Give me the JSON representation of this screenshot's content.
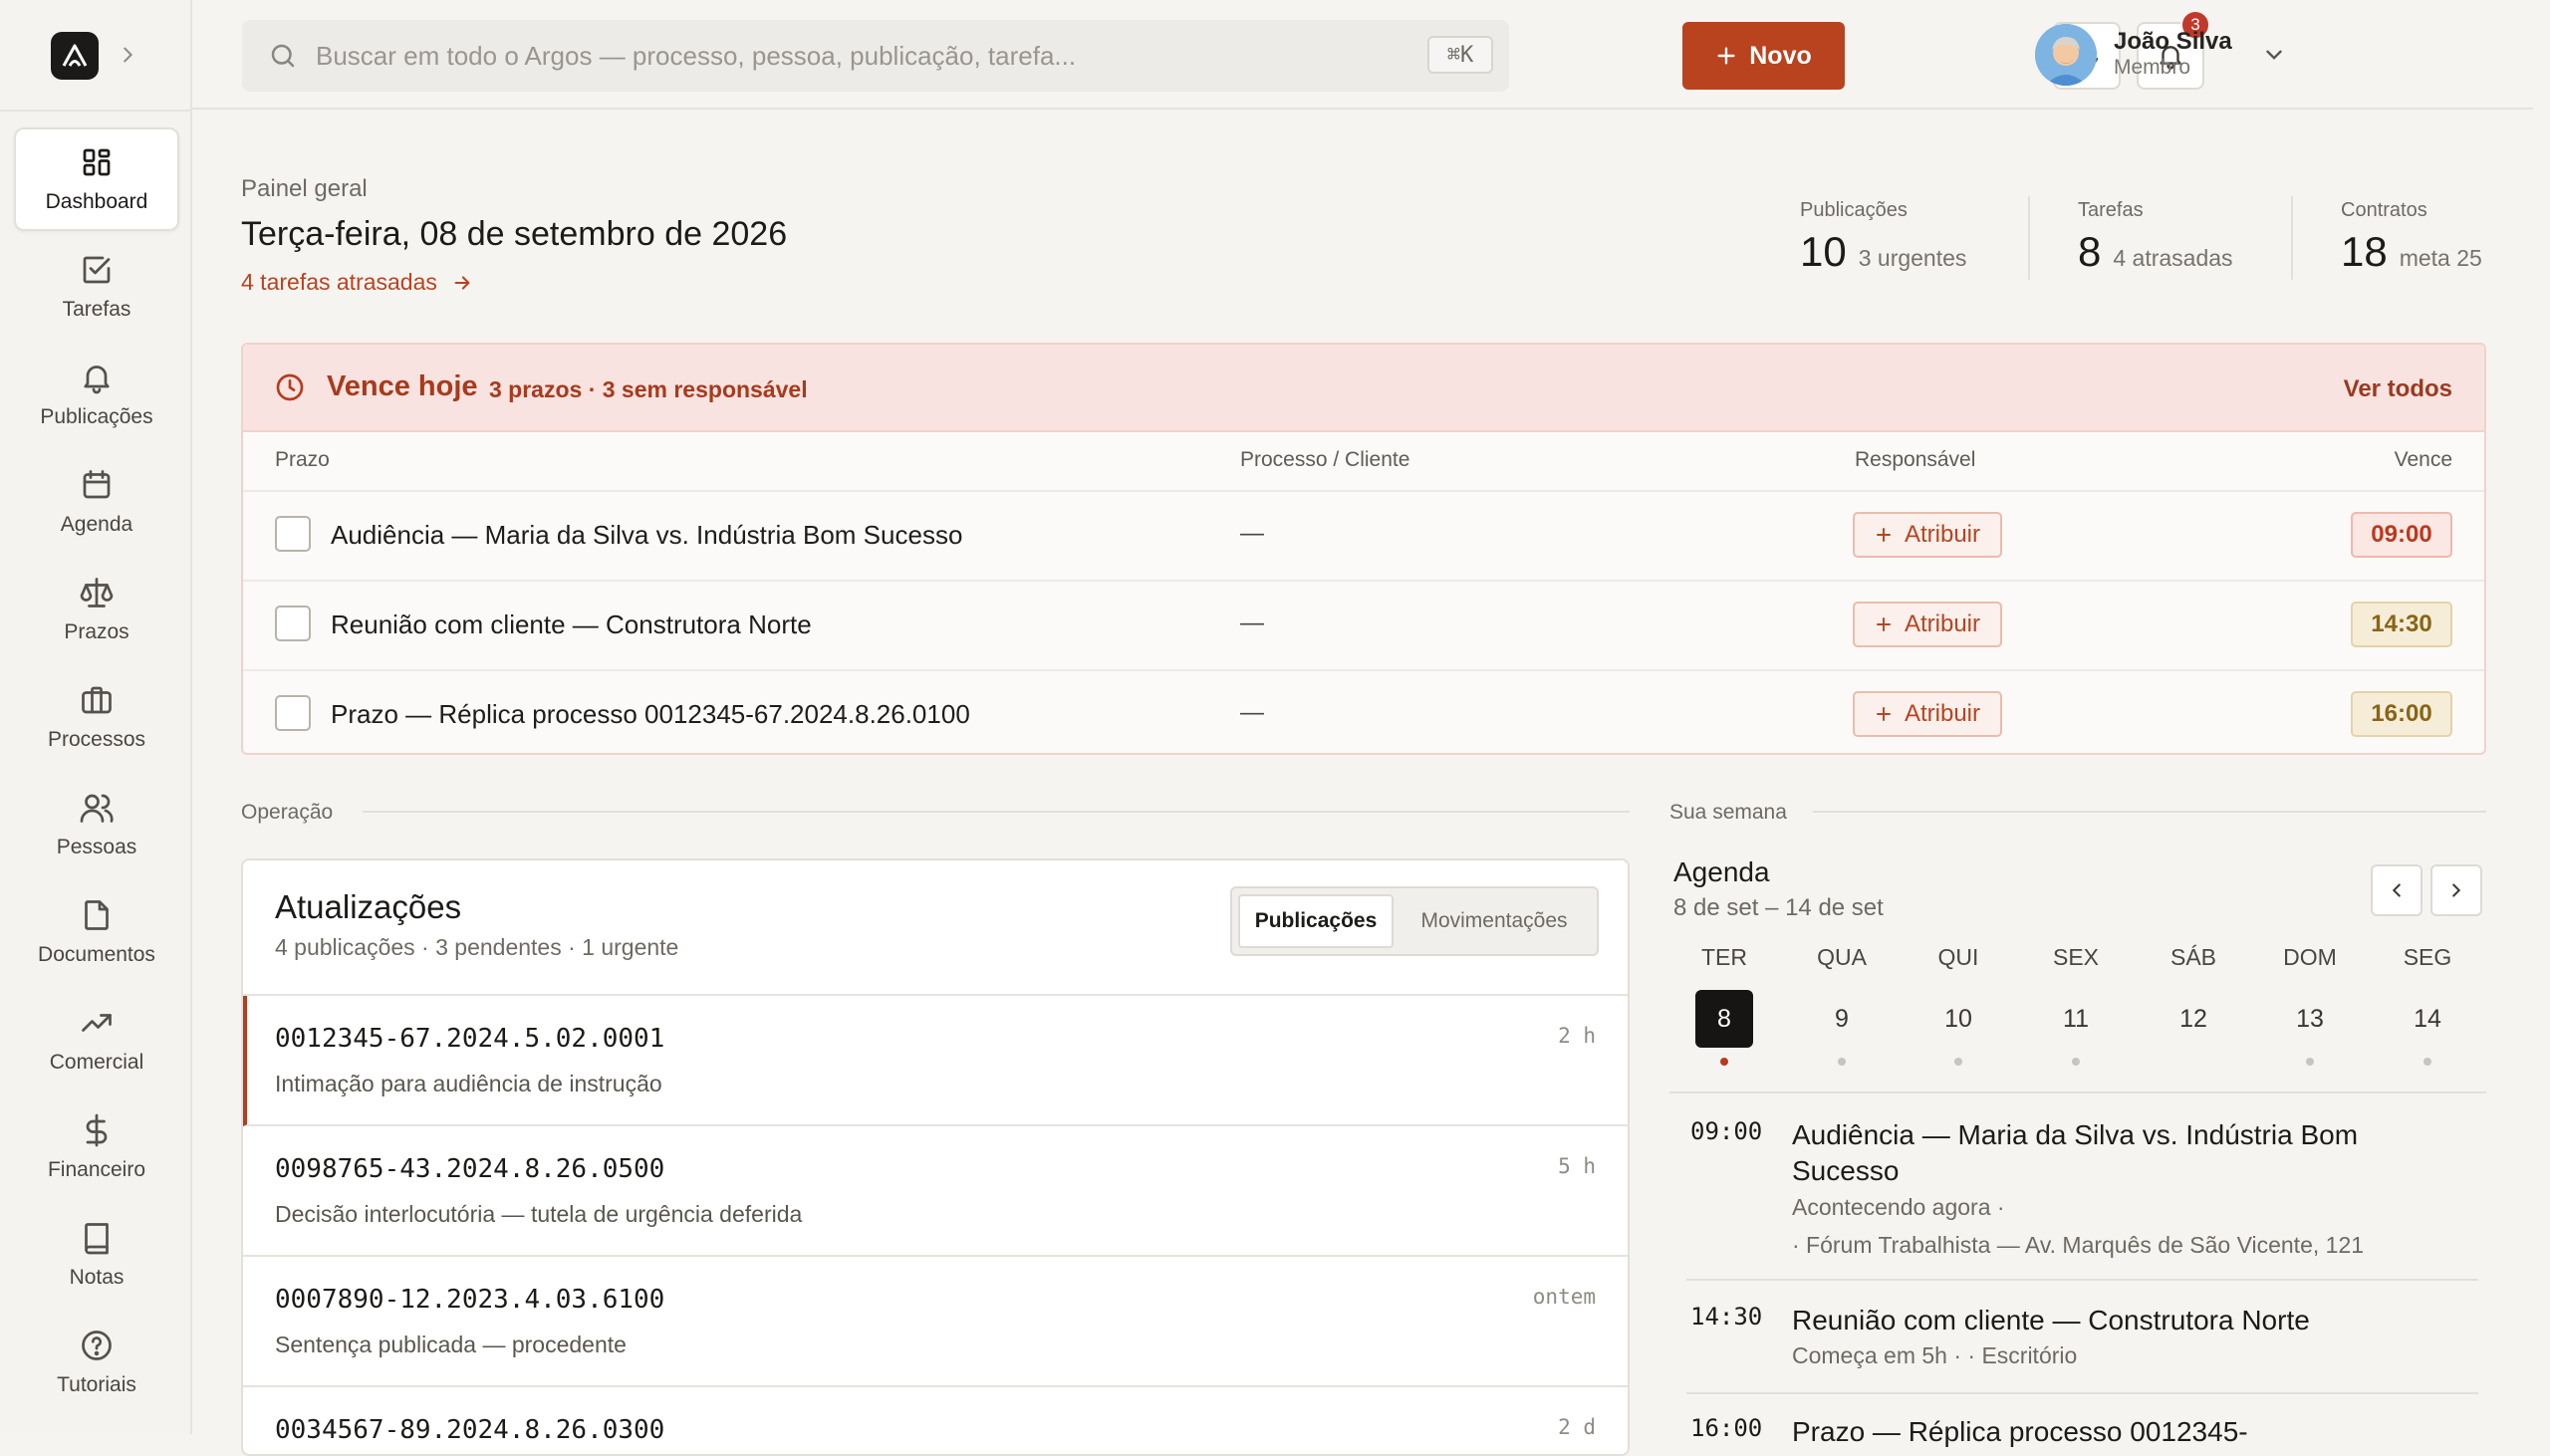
{
  "search": {
    "placeholder": "Buscar em todo o Argos — processo, pessoa, publicação, tarefa...",
    "shortcut": "⌘K"
  },
  "header": {
    "new_label": "Novo",
    "notifications_count": "3",
    "user": {
      "name": "João Silva",
      "role": "Membro"
    }
  },
  "sidebar": {
    "items": [
      {
        "label": "Dashboard",
        "icon": "grid-icon",
        "active": true
      },
      {
        "label": "Tarefas",
        "icon": "checkbox-icon"
      },
      {
        "label": "Publicações",
        "icon": "bell-icon"
      },
      {
        "label": "Agenda",
        "icon": "calendar-icon"
      },
      {
        "label": "Prazos",
        "icon": "scale-icon"
      },
      {
        "label": "Processos",
        "icon": "briefcase-icon"
      },
      {
        "label": "Pessoas",
        "icon": "users-icon"
      },
      {
        "label": "Documentos",
        "icon": "file-icon"
      },
      {
        "label": "Comercial",
        "icon": "trending-up-icon"
      },
      {
        "label": "Financeiro",
        "icon": "dollar-icon"
      },
      {
        "label": "Notas",
        "icon": "book-icon"
      },
      {
        "label": "Tutoriais",
        "icon": "help-circle-icon"
      }
    ]
  },
  "page": {
    "kicker": "Painel geral",
    "title": "Terça-feira, 08 de setembro de 2026",
    "overdue_link": "4 tarefas atrasadas"
  },
  "stats": [
    {
      "label": "Publicações",
      "value": "10",
      "sub": "3 urgentes"
    },
    {
      "label": "Tarefas",
      "value": "8",
      "sub": "4 atrasadas"
    },
    {
      "label": "Contratos",
      "value": "18",
      "sub": "meta 25"
    }
  ],
  "due_today": {
    "title": "Vence hoje",
    "subtitle": "3 prazos · 3 sem responsável",
    "see_all": "Ver todos",
    "columns": {
      "prazo": "Prazo",
      "processo": "Processo / Cliente",
      "responsavel": "Responsável",
      "vence": "Vence"
    },
    "assign_label": "Atribuir",
    "rows": [
      {
        "title": "Audiência — Maria da Silva vs. Indústria Bom Sucesso",
        "process": "—",
        "time": "09:00",
        "tone": "red"
      },
      {
        "title": "Reunião com cliente — Construtora Norte",
        "process": "—",
        "time": "14:30",
        "tone": "amber"
      },
      {
        "title": "Prazo — Réplica processo 0012345-67.2024.8.26.0100",
        "process": "—",
        "time": "16:00",
        "tone": "amber"
      }
    ]
  },
  "sections": {
    "operacao": "Operação",
    "semana": "Sua semana"
  },
  "updates": {
    "title": "Atualizações",
    "subtitle": "4 publicações · 3 pendentes · 1 urgente",
    "tabs": [
      "Publicações",
      "Movimentações"
    ],
    "items": [
      {
        "number": "0012345-67.2024.5.02.0001",
        "desc": "Intimação para audiência de instrução",
        "time": "2 h",
        "urgent": true
      },
      {
        "number": "0098765-43.2024.8.26.0500",
        "desc": "Decisão interlocutória — tutela de urgência deferida",
        "time": "5 h"
      },
      {
        "number": "0007890-12.2023.4.03.6100",
        "desc": "Sentença publicada — procedente",
        "time": "ontem"
      },
      {
        "number": "0034567-89.2024.8.26.0300",
        "desc": "",
        "time": "2 d"
      }
    ]
  },
  "agenda": {
    "title": "Agenda",
    "range": "8 de set – 14 de set",
    "days": [
      {
        "name": "TER",
        "num": "8",
        "today": true
      },
      {
        "name": "QUA",
        "num": "9"
      },
      {
        "name": "QUI",
        "num": "10"
      },
      {
        "name": "SEX",
        "num": "11"
      },
      {
        "name": "SÁB",
        "num": "12"
      },
      {
        "name": "DOM",
        "num": "13"
      },
      {
        "name": "SEG",
        "num": "14"
      }
    ],
    "events": [
      {
        "time": "09:00",
        "title": "Audiência — Maria da Silva vs. Indústria Bom Sucesso",
        "meta1": "Acontecendo agora ·",
        "meta2": "· Fórum Trabalhista — Av. Marquês de São Vicente, 121"
      },
      {
        "time": "14:30",
        "title": "Reunião com cliente — Construtora Norte",
        "meta1": "Começa em 5h · · Escritório",
        "meta2": ""
      },
      {
        "time": "16:00",
        "title": "Prazo — Réplica processo 0012345-",
        "meta1": "",
        "meta2": ""
      }
    ]
  }
}
